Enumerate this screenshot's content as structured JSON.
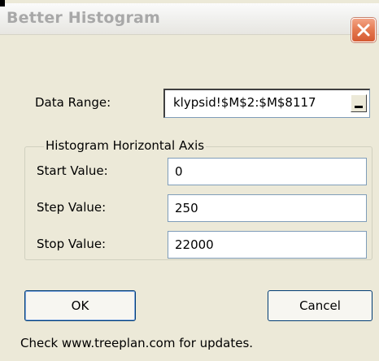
{
  "dialog": {
    "title": "Better Histogram"
  },
  "icons": {
    "close": "close-icon",
    "collapse": "collapse-dialog-icon"
  },
  "data_range": {
    "label": "Data Range:",
    "value": "klypsid!$M$2:$M$8117"
  },
  "axis_group": {
    "legend": "Histogram Horizontal Axis",
    "start_label": "Start Value:",
    "start_value": "0",
    "step_label": "Step Value:",
    "step_value": "250",
    "stop_label": "Stop Value:",
    "stop_value": "22000"
  },
  "buttons": {
    "ok": "OK",
    "cancel": "Cancel"
  },
  "footer": {
    "note": "Check www.treeplan.com for updates."
  },
  "colors": {
    "dialog_bg": "#ece9d8",
    "close_button": "#e4784f",
    "title_text": "#a8a8a8"
  }
}
